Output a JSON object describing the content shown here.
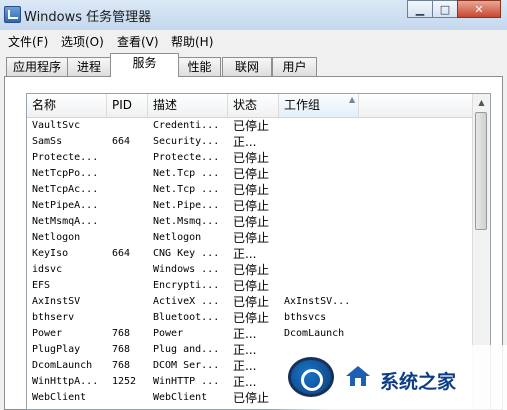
{
  "window": {
    "title": "Windows 任务管理器"
  },
  "window_buttons": {
    "minimize": "▁",
    "maximize": "□",
    "close": "✕"
  },
  "menu": [
    "文件(F)",
    "选项(O)",
    "查看(V)",
    "帮助(H)"
  ],
  "tabs": [
    "应用程序",
    "进程",
    "服务",
    "性能",
    "联网",
    "用户"
  ],
  "active_tab": "服务",
  "columns": [
    "名称",
    "PID",
    "描述",
    "状态",
    "工作组"
  ],
  "sorted_column": "工作组",
  "rows": [
    {
      "name": "VaultSvc",
      "pid": "",
      "desc": "Credenti...",
      "status": "已停止",
      "group": ""
    },
    {
      "name": "SamSs",
      "pid": "664",
      "desc": "Security...",
      "status": "正...",
      "group": ""
    },
    {
      "name": "Protecte...",
      "pid": "",
      "desc": "Protecte...",
      "status": "已停止",
      "group": ""
    },
    {
      "name": "NetTcpPo...",
      "pid": "",
      "desc": "Net.Tcp ...",
      "status": "已停止",
      "group": ""
    },
    {
      "name": "NetTcpAc...",
      "pid": "",
      "desc": "Net.Tcp ...",
      "status": "已停止",
      "group": ""
    },
    {
      "name": "NetPipeA...",
      "pid": "",
      "desc": "Net.Pipe...",
      "status": "已停止",
      "group": ""
    },
    {
      "name": "NetMsmqA...",
      "pid": "",
      "desc": "Net.Msmq...",
      "status": "已停止",
      "group": ""
    },
    {
      "name": "Netlogon",
      "pid": "",
      "desc": "Netlogon",
      "status": "已停止",
      "group": ""
    },
    {
      "name": "KeyIso",
      "pid": "664",
      "desc": "CNG Key ...",
      "status": "正...",
      "group": ""
    },
    {
      "name": "idsvc",
      "pid": "",
      "desc": "Windows ...",
      "status": "已停止",
      "group": ""
    },
    {
      "name": "EFS",
      "pid": "",
      "desc": "Encrypti...",
      "status": "已停止",
      "group": ""
    },
    {
      "name": "AxInstSV",
      "pid": "",
      "desc": "ActiveX ...",
      "status": "已停止",
      "group": "AxInstSV..."
    },
    {
      "name": "bthserv",
      "pid": "",
      "desc": "Bluetoot...",
      "status": "已停止",
      "group": "bthsvcs"
    },
    {
      "name": "Power",
      "pid": "768",
      "desc": "Power",
      "status": "正...",
      "group": "DcomLaunch"
    },
    {
      "name": "PlugPlay",
      "pid": "768",
      "desc": "Plug and...",
      "status": "正...",
      "group": ""
    },
    {
      "name": "DcomLaunch",
      "pid": "768",
      "desc": "DCOM Ser...",
      "status": "正...",
      "group": ""
    },
    {
      "name": "WinHttpA...",
      "pid": "1252",
      "desc": "WinHTTP ...",
      "status": "正...",
      "group": ""
    },
    {
      "name": "WebClient",
      "pid": "",
      "desc": "WebClient",
      "status": "已停止",
      "group": ""
    }
  ],
  "watermark": {
    "text": "系统之家"
  }
}
